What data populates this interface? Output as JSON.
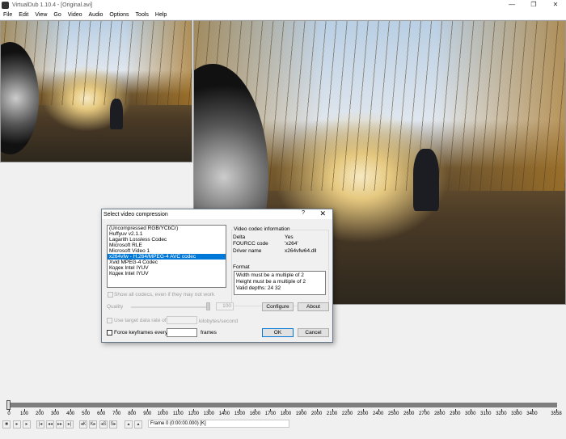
{
  "window": {
    "title": "VirtualDub 1.10.4 - [Original.avi]",
    "minimize": "—",
    "maximize": "❐",
    "close": "✕"
  },
  "menu": [
    "File",
    "Edit",
    "View",
    "Go",
    "Video",
    "Audio",
    "Options",
    "Tools",
    "Help"
  ],
  "dialog": {
    "title": "Select video compression",
    "help": "?",
    "close": "✕",
    "codecs": [
      "(Uncompressed RGB/YCbCr)",
      "Huffyuv v2.1.1",
      "Lagarith Lossless Codec",
      "Microsoft RLE",
      "Microsoft Video 1",
      "x264vfw - H.264/MPEG-4 AVC codec",
      "Xvid MPEG-4 Codec",
      "Кодек Intel IYUV",
      "Кодек Intel IYUV"
    ],
    "selected_index": 5,
    "info_title": "Video codec information",
    "info": [
      {
        "k": "Delta",
        "v": "Yes"
      },
      {
        "k": "FOURCC code",
        "v": "'x264'"
      },
      {
        "k": "Driver name",
        "v": "x264vfw64.dll"
      }
    ],
    "format_label": "Format",
    "format": [
      "Width must be a multiple of 2",
      "Height must be a multiple of 2",
      "Valid depths: 24 32"
    ],
    "show_all": "Show all codecs, even if they may not work",
    "quality_label": "Quality",
    "quality_value": "100",
    "configure": "Configure",
    "about": "About",
    "target_rate": "Use target data rate of",
    "rate_unit": "kilobytes/second",
    "keyframes": "Force keyframes every",
    "frames": "frames",
    "ok": "OK",
    "cancel": "Cancel"
  },
  "timeline": {
    "ticks": [
      "0",
      "100",
      "200",
      "300",
      "400",
      "500",
      "600",
      "700",
      "800",
      "900",
      "1000",
      "1100",
      "1200",
      "1300",
      "1400",
      "1500",
      "1600",
      "1700",
      "1800",
      "1900",
      "2000",
      "2100",
      "2200",
      "2300",
      "2400",
      "2500",
      "2600",
      "2700",
      "2800",
      "2900",
      "3000",
      "3100",
      "3200",
      "3300",
      "3400",
      "3558"
    ],
    "max": 3558,
    "position": 0
  },
  "status": "Frame 0 (0:00:00.000) [K]"
}
